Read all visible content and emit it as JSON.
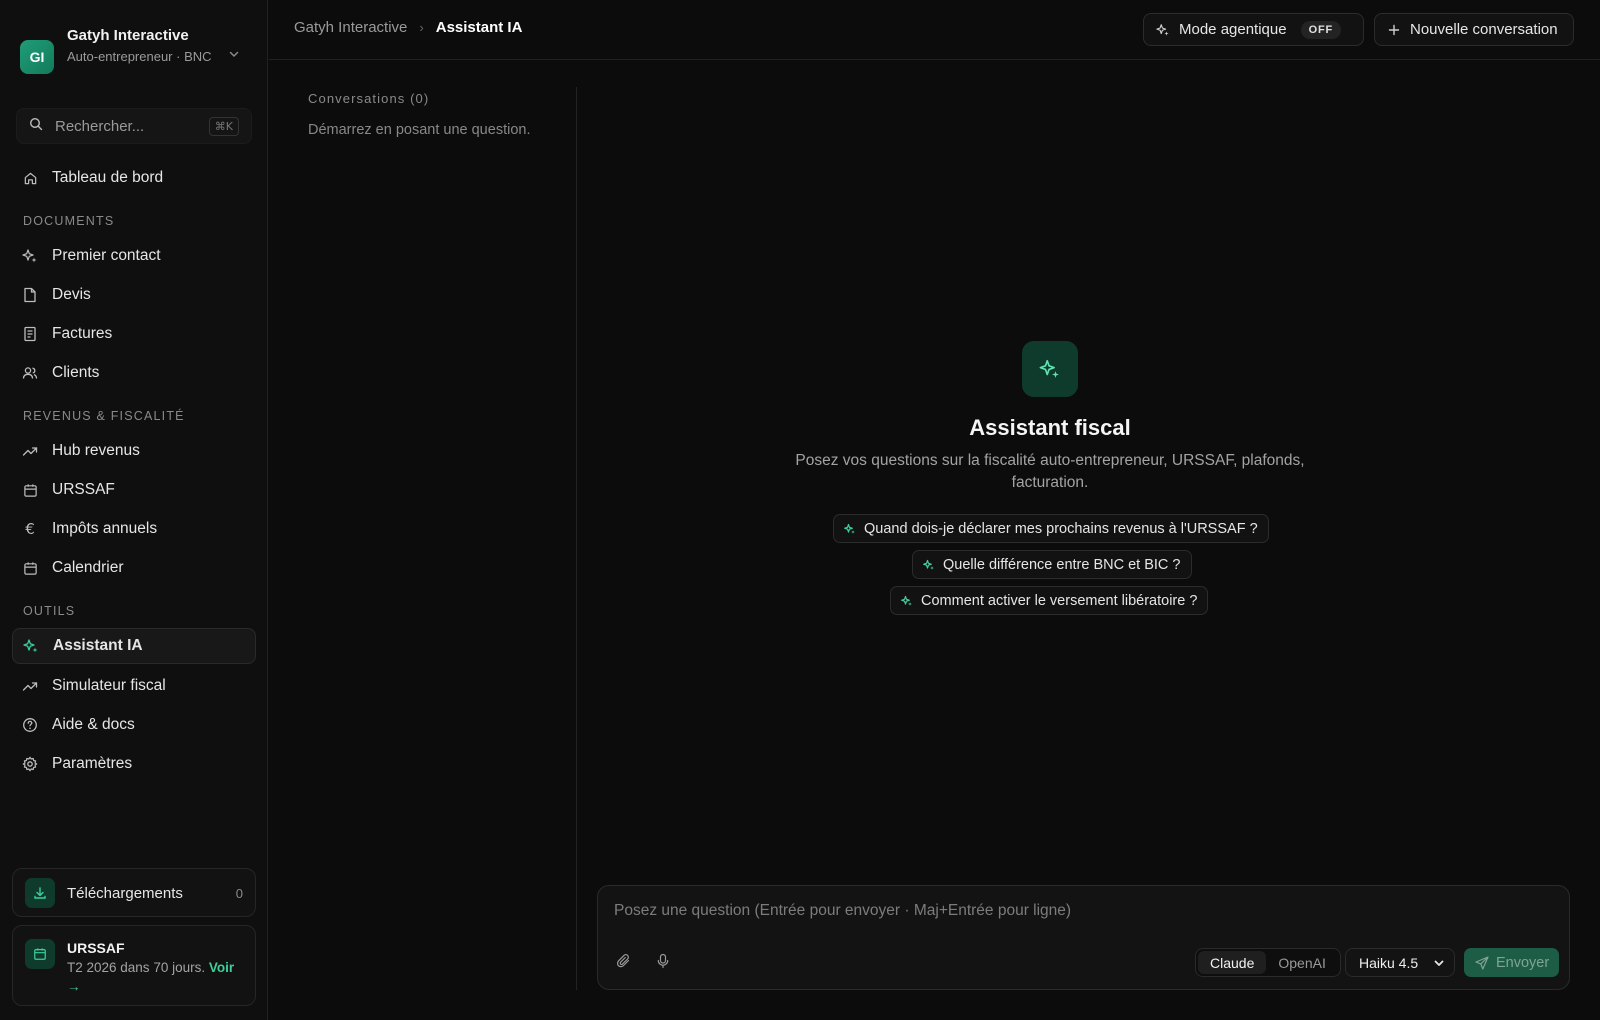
{
  "org": {
    "initials": "GI",
    "name": "Gatyh Interactive",
    "subtitle": "Auto-entrepreneur · BNC"
  },
  "search": {
    "placeholder": "Rechercher...",
    "shortcut": "⌘K"
  },
  "nav": {
    "dashboard": "Tableau de bord",
    "sections": [
      {
        "label": "Documents",
        "items": [
          "Premier contact",
          "Devis",
          "Factures",
          "Clients"
        ]
      },
      {
        "label": "Revenus & fiscalité",
        "items": [
          "Hub revenus",
          "URSSAF",
          "Impôts annuels",
          "Calendrier"
        ]
      },
      {
        "label": "Outils",
        "items": [
          "Assistant IA",
          "Simulateur fiscal",
          "Aide & docs",
          "Paramètres"
        ]
      }
    ],
    "active": "Assistant IA"
  },
  "downloads_card": {
    "label": "Téléchargements",
    "count": "0"
  },
  "urssaf_card": {
    "title": "URSSAF",
    "text": "T2 2026 dans 70 jours.",
    "link": "Voir →"
  },
  "header": {
    "breadcrumb": [
      "Gatyh Interactive",
      "Assistant IA"
    ],
    "agent_mode_label": "Mode agentique",
    "agent_mode_state": "OFF",
    "new_conversation_label": "Nouvelle conversation"
  },
  "conversations": {
    "title": "Conversations (0)",
    "empty": "Démarrez en posant une question."
  },
  "assistant": {
    "title": "Assistant fiscal",
    "subtitle": "Posez vos questions sur la fiscalité auto-entrepreneur, URSSAF, plafonds, facturation.",
    "suggestions": [
      "Quand dois-je déclarer mes prochains revenus à l'URSSAF ?",
      "Quelle différence entre BNC et BIC ?",
      "Comment activer le versement libératoire ?"
    ]
  },
  "composer": {
    "placeholder": "Posez une question (Entrée pour envoyer · Maj+Entrée pour ligne)",
    "providers": [
      "Claude",
      "OpenAI"
    ],
    "selected_provider": "Claude",
    "model": "Haiku 4.5",
    "send_label": "Envoyer"
  },
  "colors": {
    "accent": "#1f9d78",
    "accent_dark": "#0f3b2c",
    "background": "#0c0c0c",
    "send_disabled": "#1d5c45"
  }
}
